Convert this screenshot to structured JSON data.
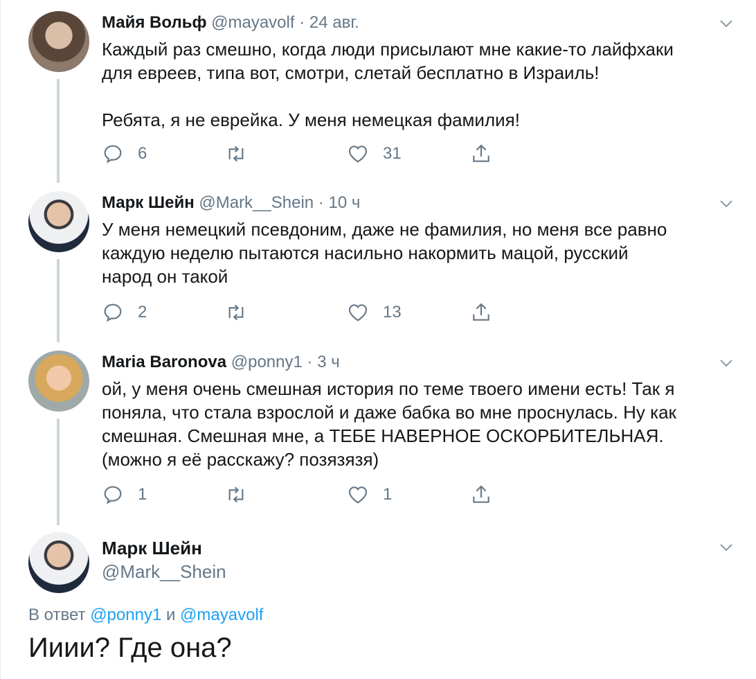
{
  "tweets": [
    {
      "name": "Майя Вольф",
      "handle": "@mayavolf",
      "sep": "·",
      "time": "24 авг.",
      "text": "Каждый раз смешно, когда люди присылают мне какие-то лайфхаки\nдля евреев, типа вот, смотри, слетай бесплатно в Израиль!\n\nРебята, я не еврейка. У меня немецкая фамилия!",
      "replies": "6",
      "retweets": "",
      "likes": "31"
    },
    {
      "name": "Марк Шейн",
      "handle": "@Mark__Shein",
      "sep": "·",
      "time": "10 ч",
      "text": "У меня немецкий псевдоним, даже не фамилия, но меня все равно\nкаждую неделю пытаются насильно накормить мацой, русский\nнарод он такой",
      "replies": "2",
      "retweets": "",
      "likes": "13"
    },
    {
      "name": "Maria Baronova",
      "handle": "@ponny1",
      "sep": "·",
      "time": "3 ч",
      "text": "ой, у меня очень смешная история по теме твоего имени есть! Так я\nпоняла, что стала взрослой и даже бабка во мне проснулась. Ну как\nсмешная. Смешная мне, а ТЕБЕ НАВЕРНОЕ ОСКОРБИТЕЛЬНАЯ.\n(можно я её расскажу? позязязя)",
      "replies": "1",
      "retweets": "",
      "likes": "1"
    }
  ],
  "focus": {
    "name": "Марк Шейн",
    "handle": "@Mark__Shein",
    "reply_prefix": "В ответ",
    "mention1": "@ponny1",
    "conj": "и",
    "mention2": "@mayavolf",
    "text": "Ииии? Где она?"
  },
  "icons": {
    "reply": "reply-icon",
    "retweet": "retweet-icon",
    "like": "heart-icon",
    "share": "share-icon",
    "menu": "chevron-down-icon"
  },
  "colors": {
    "text": "#14171a",
    "muted": "#657786",
    "link": "#1da1f2",
    "thread_line": "#ccd6dd"
  }
}
